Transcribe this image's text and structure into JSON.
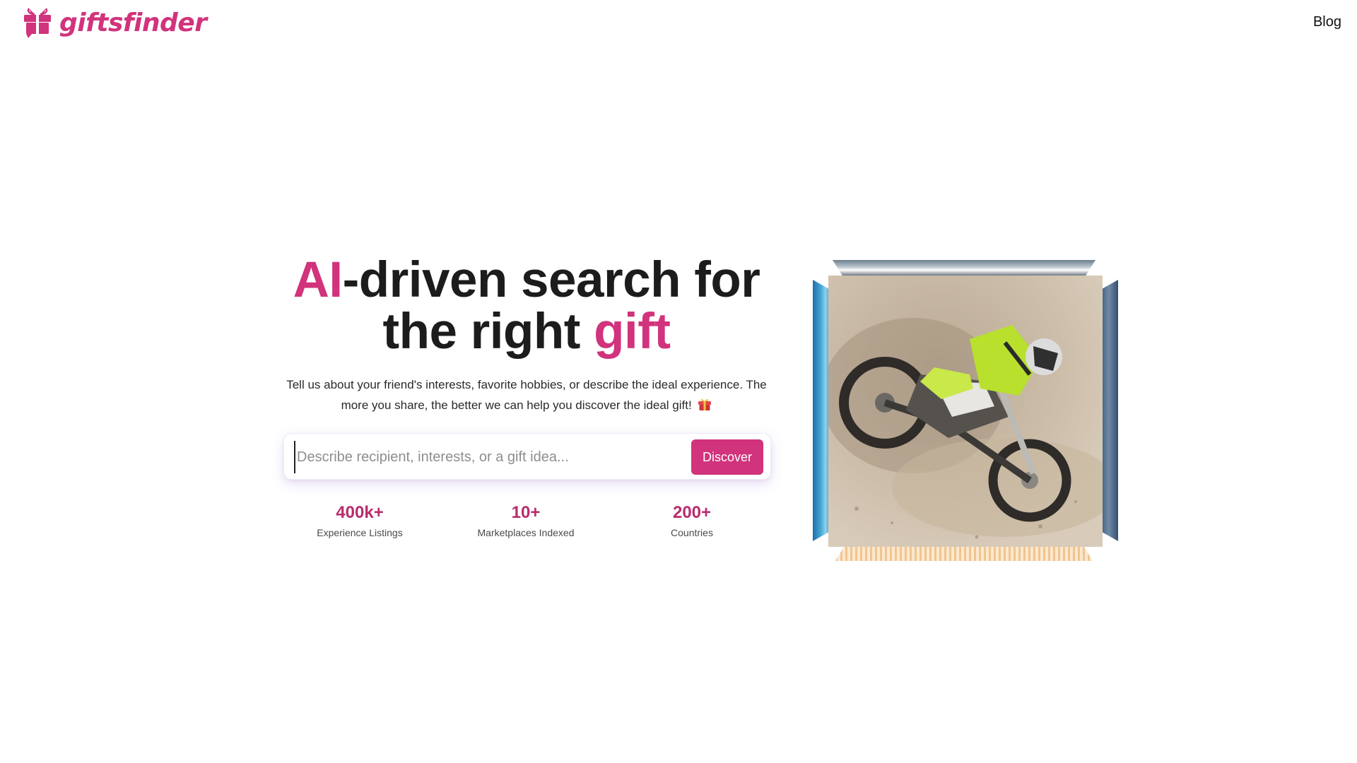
{
  "header": {
    "logo_text": "giftsfinder",
    "nav": {
      "blog_label": "Blog"
    }
  },
  "hero": {
    "headline": {
      "accent_1": "AI",
      "part_1": "-driven search for",
      "part_2": "the right ",
      "accent_2": "gift"
    },
    "description": "Tell us about your friend's interests, favorite hobbies, or describe the ideal experience. The more you share, the better we can help you discover the ideal gift!",
    "search": {
      "placeholder": "Describe recipient, interests, or a gift idea...",
      "value": "",
      "button_label": "Discover"
    },
    "stats": [
      {
        "value": "400k+",
        "label": "Experience Listings"
      },
      {
        "value": "10+",
        "label": "Marketplaces Indexed"
      },
      {
        "value": "200+",
        "label": "Countries"
      }
    ],
    "image": {
      "icon": "motocross-photo"
    }
  },
  "colors": {
    "brand": "#d1337c",
    "stat": "#b82c6e",
    "text": "#1c1c1c"
  }
}
